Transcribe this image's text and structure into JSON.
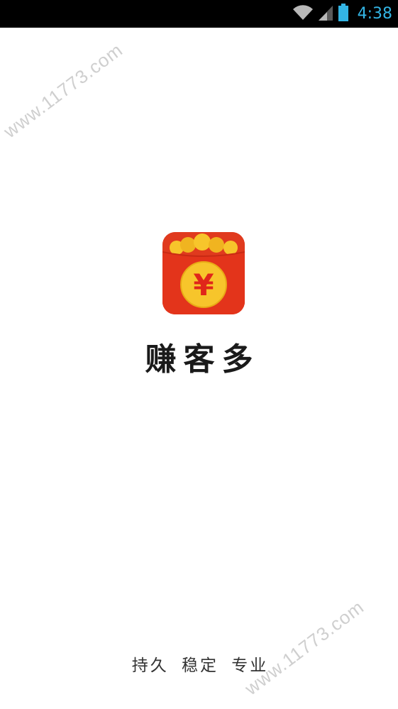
{
  "status_bar": {
    "time": "4:38",
    "icons": [
      "wifi-icon",
      "cell-signal-icon",
      "battery-icon"
    ],
    "accent_color": "#33b5e5"
  },
  "watermark": {
    "text": "www.11773.com"
  },
  "app": {
    "icon_symbol": "¥",
    "name": "赚客多",
    "slogan": "持久 稳定 专业",
    "brand_color": "#e03a1e",
    "coin_color": "#f7c52b"
  }
}
